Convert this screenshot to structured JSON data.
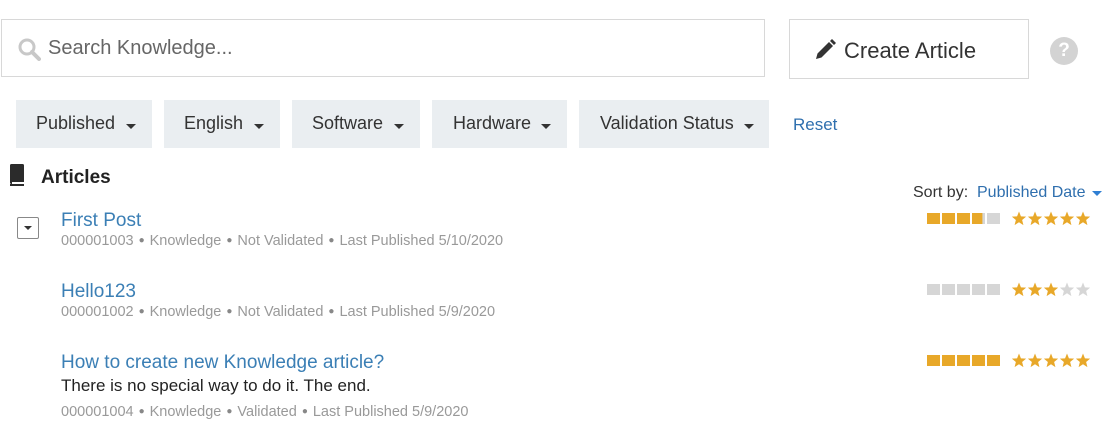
{
  "search": {
    "placeholder": "Search Knowledge..."
  },
  "toolbar": {
    "create_label": "Create Article",
    "help_symbol": "?"
  },
  "filters": [
    {
      "label": "Published"
    },
    {
      "label": "English"
    },
    {
      "label": "Software"
    },
    {
      "label": "Hardware"
    },
    {
      "label": "Validation Status"
    }
  ],
  "reset_label": "Reset",
  "section": {
    "title": "Articles"
  },
  "sort": {
    "label": "Sort by:",
    "value": "Published Date"
  },
  "articles": [
    {
      "title": "First Post",
      "number": "000001003",
      "type": "Knowledge",
      "validation": "Not Validated",
      "published": "Last Published 5/10/2020",
      "summary": "",
      "views_level": 3.8,
      "stars": 5
    },
    {
      "title": "Hello123",
      "number": "000001002",
      "type": "Knowledge",
      "validation": "Not Validated",
      "published": "Last Published 5/9/2020",
      "summary": "",
      "views_level": 0,
      "stars": 3
    },
    {
      "title": "How to create new Knowledge article?",
      "number": "000001004",
      "type": "Knowledge",
      "validation": "Validated",
      "published": "Last Published 5/9/2020",
      "summary": "There is no special way to do it. The end.",
      "views_level": 5,
      "stars": 5
    }
  ],
  "colors": {
    "accent_link": "#3b7fb5",
    "rating_fill": "#e8a829",
    "rating_empty": "#d6d6d6",
    "filter_bg": "#eaeef1"
  }
}
